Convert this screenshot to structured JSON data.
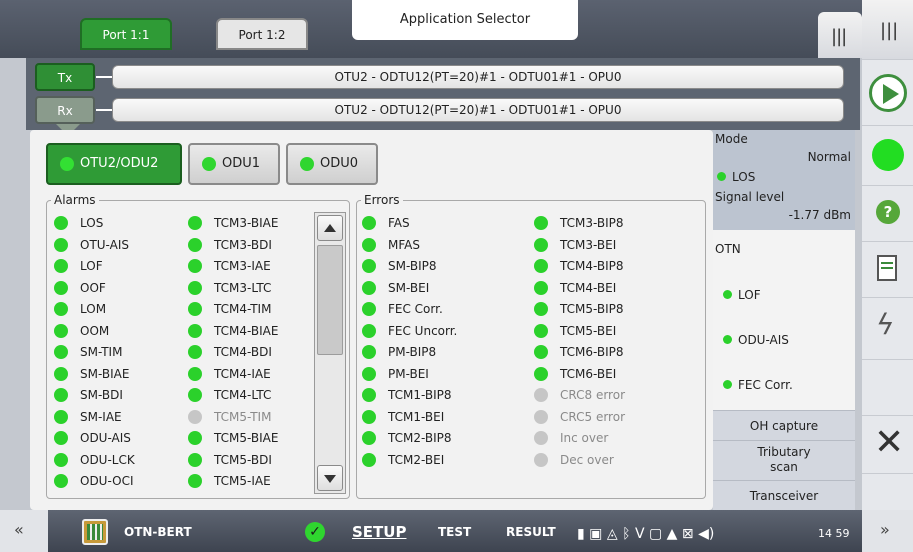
{
  "top": {
    "port_tabs": [
      "Port 1:1",
      "Port 1:2"
    ],
    "app_selector": "Application Selector"
  },
  "paths": {
    "tx_label": "Tx",
    "rx_label": "Rx",
    "tx_path": "OTU2 - ODTU12(PT=20)#1 - ODTU01#1 - OPU0",
    "rx_path": "OTU2 - ODTU12(PT=20)#1 - ODTU01#1 - OPU0"
  },
  "layer_buttons": [
    "OTU2/ODU2",
    "ODU1",
    "ODU0"
  ],
  "alarms": {
    "legend": "Alarms",
    "col1": [
      "LOS",
      "OTU-AIS",
      "LOF",
      "OOF",
      "LOM",
      "OOM",
      "SM-TIM",
      "SM-BIAE",
      "SM-BDI",
      "SM-IAE",
      "ODU-AIS",
      "ODU-LCK",
      "ODU-OCI"
    ],
    "col2": [
      "TCM3-BIAE",
      "TCM3-BDI",
      "TCM3-IAE",
      "TCM3-LTC",
      "TCM4-TIM",
      "TCM4-BIAE",
      "TCM4-BDI",
      "TCM4-IAE",
      "TCM4-LTC",
      "TCM5-TIM",
      "TCM5-BIAE",
      "TCM5-BDI",
      "TCM5-IAE"
    ],
    "col2_disabled": [
      "TCM5-TIM"
    ]
  },
  "errors": {
    "legend": "Errors",
    "col1": [
      "FAS",
      "MFAS",
      "SM-BIP8",
      "SM-BEI",
      "FEC Corr.",
      "FEC Uncorr.",
      "PM-BIP8",
      "PM-BEI",
      "TCM1-BIP8",
      "TCM1-BEI",
      "TCM2-BIP8",
      "TCM2-BEI"
    ],
    "col2": [
      "TCM3-BIP8",
      "TCM3-BEI",
      "TCM4-BIP8",
      "TCM4-BEI",
      "TCM5-BIP8",
      "TCM5-BEI",
      "TCM6-BIP8",
      "TCM6-BEI",
      "CRC8 error",
      "CRC5 error",
      "Inc over",
      "Dec over"
    ],
    "col2_disabled": [
      "CRC8 error",
      "CRC5 error",
      "Inc over",
      "Dec over"
    ]
  },
  "mode_panel": {
    "mode_label": "Mode",
    "mode_value": "Normal",
    "los": "LOS",
    "signal_label": "Signal level",
    "signal_value": "-1.77 dBm"
  },
  "otn_panel": {
    "title": "OTN",
    "items": [
      "LOF",
      "ODU-AIS",
      "FEC Corr."
    ]
  },
  "side_buttons": [
    "OH capture",
    "Tributary scan",
    "Transceiver"
  ],
  "bottom": {
    "app_name": "OTN-BERT",
    "nav": [
      "SETUP",
      "TEST",
      "RESULT"
    ],
    "clock": "14 59"
  },
  "colors": {
    "status_green": "#2bd12b",
    "active_tab": "#2f9b36",
    "disabled_grey": "#c6c6c6"
  }
}
